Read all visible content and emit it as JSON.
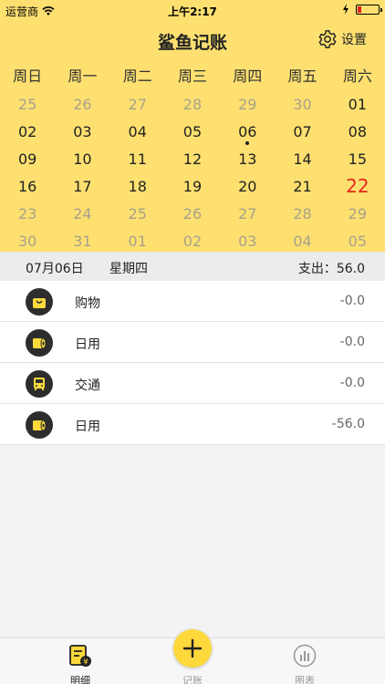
{
  "status": {
    "carrier": "运营商",
    "time": "上午2:17"
  },
  "nav": {
    "title": "鲨鱼记账",
    "settings_label": "设置"
  },
  "weekdays": [
    "周日",
    "周一",
    "周二",
    "周三",
    "周四",
    "周五",
    "周六"
  ],
  "calendar": {
    "rows": [
      [
        "25",
        "26",
        "27",
        "28",
        "29",
        "30",
        "01"
      ],
      [
        "02",
        "03",
        "04",
        "05",
        "06",
        "07",
        "08"
      ],
      [
        "09",
        "10",
        "11",
        "12",
        "13",
        "14",
        "15"
      ],
      [
        "16",
        "17",
        "18",
        "19",
        "20",
        "21",
        "22"
      ],
      [
        "23",
        "24",
        "25",
        "26",
        "27",
        "28",
        "29"
      ],
      [
        "30",
        "31",
        "01",
        "02",
        "03",
        "04",
        "05"
      ]
    ],
    "today_color": "#e4281c"
  },
  "day": {
    "date": "07月06日",
    "weekday": "星期四",
    "total": "支出：56.0"
  },
  "entries": [
    {
      "name": "购物",
      "amount": "-0.0",
      "icon": "shopping-bag-icon"
    },
    {
      "name": "日用",
      "amount": "-0.0",
      "icon": "tissue-roll-icon"
    },
    {
      "name": "交通",
      "amount": "-0.0",
      "icon": "bus-icon"
    },
    {
      "name": "日用",
      "amount": "-56.0",
      "icon": "tissue-roll-icon"
    }
  ],
  "tabs": {
    "detail": "明细",
    "record": "记账",
    "chart": "图表"
  },
  "colors": {
    "header_bg": "#fde070",
    "fab": "#fdd93c"
  }
}
